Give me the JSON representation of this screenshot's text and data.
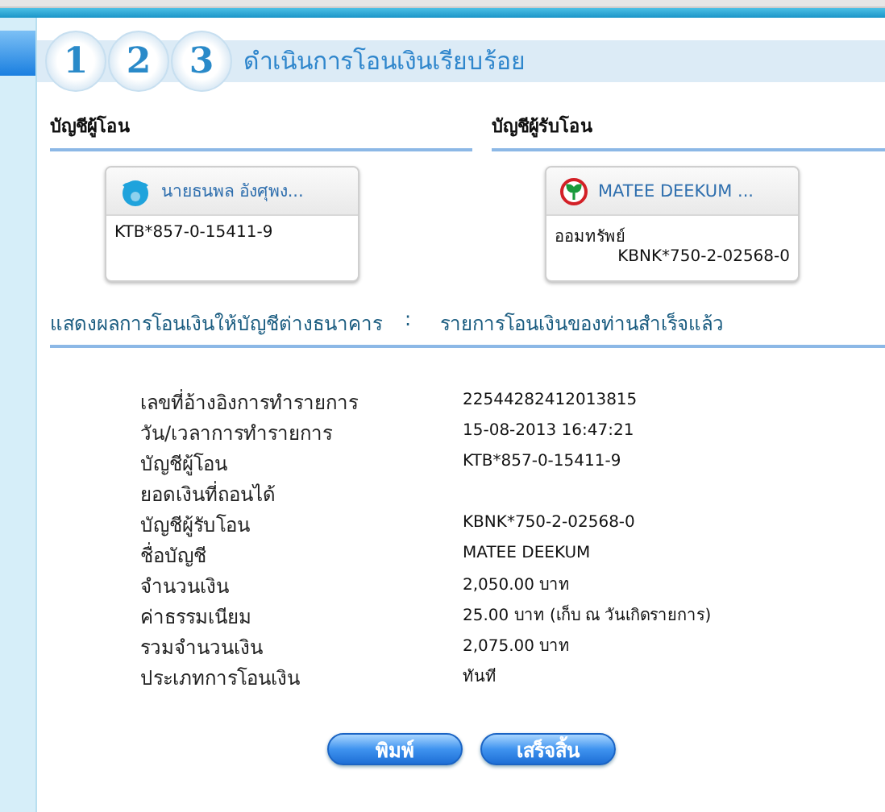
{
  "steps": [
    "1",
    "2",
    "3"
  ],
  "title": "ดำเนินการโอนเงินเรียบร้อย",
  "accounts": [
    {
      "heading": "บัญชีผู้โอน",
      "kind": "ktb",
      "name": "นายธนพล อังศุพง...",
      "number": "KTB*857-0-15411-9"
    },
    {
      "heading": "บัญชีผู้รับโอน",
      "kind": "kbank",
      "name": "MATEE DEEKUM ...",
      "type": "ออมทรัพย์",
      "number": "KBNK*750-2-02568-0"
    }
  ],
  "result": {
    "label": "แสดงผลการโอนเงินให้บัญชีต่างธนาคาร",
    "separator": ":",
    "status": "รายการโอนเงินของท่านสำเร็จแล้ว"
  },
  "details": [
    {
      "label": "เลขที่อ้างอิงการทำรายการ",
      "value": "22544282412013815"
    },
    {
      "label": "วัน/เวลาการทำรายการ",
      "value": "15-08-2013 16:47:21"
    },
    {
      "label": "บัญชีผู้โอน",
      "value": "KTB*857-0-15411-9"
    },
    {
      "label": "ยอดเงินที่ถอนได้"
    },
    {
      "label": "บัญชีผู้รับโอน",
      "value": "KBNK*750-2-02568-0"
    },
    {
      "label": "ชื่อบัญชี",
      "value": "MATEE DEEKUM"
    },
    {
      "label": "จำนวนเงิน",
      "value": "2,050.00 บาท"
    },
    {
      "label": "ค่าธรรมเนียม",
      "value": "25.00 บาท (เก็บ ณ วันเกิดรายการ)"
    },
    {
      "label": "รวมจำนวนเงิน",
      "value": "2,075.00 บาท"
    },
    {
      "label": "ประเภทการโอนเงิน",
      "value": "ทันที"
    }
  ],
  "buttons": [
    "พิมพ์",
    "เสร็จสิ้น"
  ]
}
